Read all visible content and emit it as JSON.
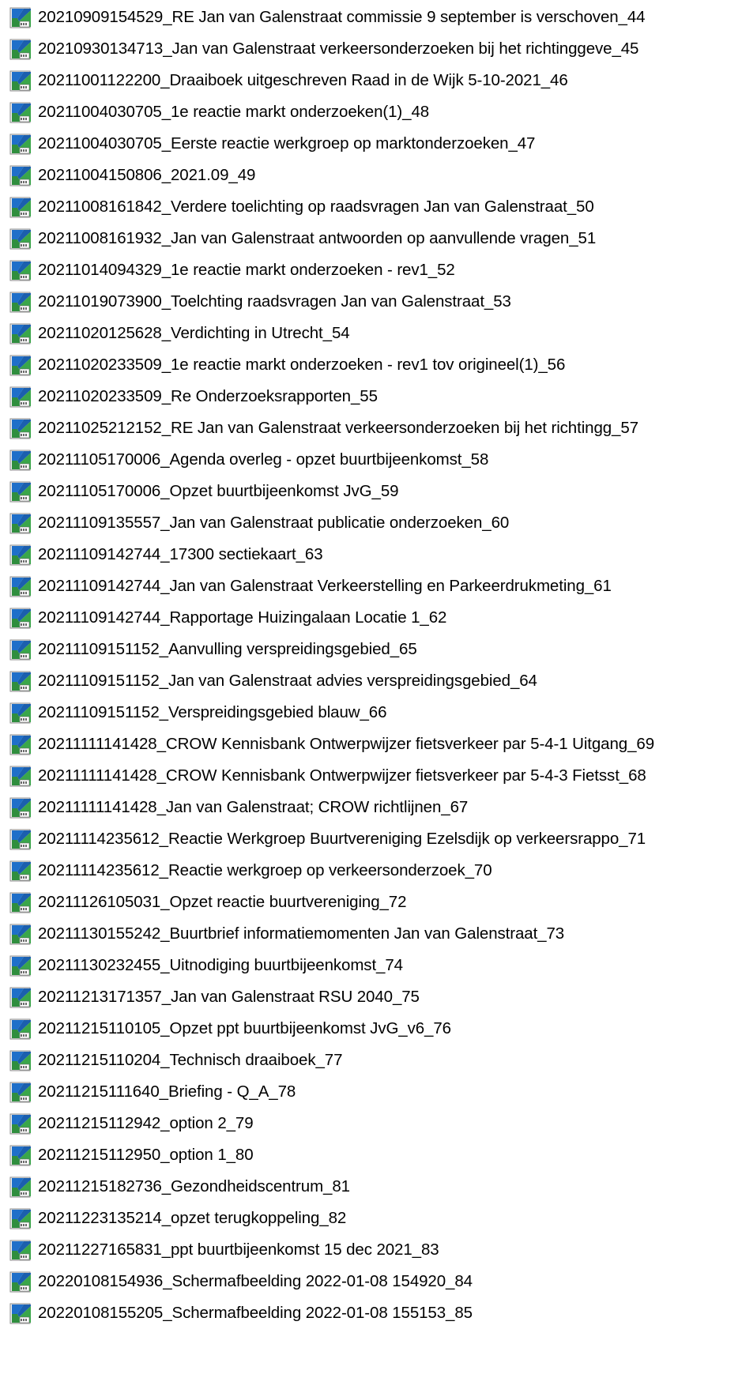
{
  "icon": "pdf-app-icon",
  "colors": {
    "icon_blue": "#1f6fc9",
    "icon_green": "#3aa64a",
    "icon_page": "#f2f2f2",
    "text": "#000000",
    "background": "#ffffff"
  },
  "files": [
    "20210909154529_RE Jan van Galenstraat commissie 9 september is verschoven_44",
    "20210930134713_Jan van Galenstraat verkeersonderzoeken bij het richtinggeve_45",
    "20211001122200_Draaiboek uitgeschreven Raad in de Wijk 5-10-2021_46",
    "20211004030705_1e reactie markt onderzoeken(1)_48",
    "20211004030705_Eerste reactie werkgroep op marktonderzoeken_47",
    "20211004150806_2021.09_49",
    "20211008161842_Verdere toelichting op raadsvragen Jan van Galenstraat_50",
    "20211008161932_Jan van Galenstraat antwoorden op aanvullende vragen_51",
    "20211014094329_1e reactie markt onderzoeken - rev1_52",
    "20211019073900_Toelchting raadsvragen Jan van Galenstraat_53",
    "20211020125628_Verdichting in Utrecht_54",
    "20211020233509_1e reactie markt onderzoeken - rev1 tov origineel(1)_56",
    "20211020233509_Re Onderzoeksrapporten_55",
    "20211025212152_RE Jan van Galenstraat verkeersonderzoeken bij het richtingg_57",
    "20211105170006_Agenda overleg - opzet buurtbijeenkomst_58",
    "20211105170006_Opzet buurtbijeenkomst JvG_59",
    "20211109135557_Jan van Galenstraat publicatie onderzoeken_60",
    "20211109142744_17300 sectiekaart_63",
    "20211109142744_Jan van Galenstraat Verkeerstelling en Parkeerdrukmeting_61",
    "20211109142744_Rapportage Huizingalaan Locatie 1_62",
    "20211109151152_Aanvulling verspreidingsgebied_65",
    "20211109151152_Jan van Galenstraat advies verspreidingsgebied_64",
    "20211109151152_Verspreidingsgebied blauw_66",
    "20211111141428_CROW Kennisbank Ontwerpwijzer fietsverkeer par 5-4-1 Uitgang_69",
    "20211111141428_CROW Kennisbank Ontwerpwijzer fietsverkeer par 5-4-3 Fietsst_68",
    "20211111141428_Jan van Galenstraat; CROW richtlijnen_67",
    "20211114235612_Reactie Werkgroep Buurtvereniging Ezelsdijk op verkeersrappo_71",
    "20211114235612_Reactie werkgroep op verkeersonderzoek_70",
    "20211126105031_Opzet reactie buurtvereniging_72",
    "20211130155242_Buurtbrief informatiemomenten Jan van Galenstraat_73",
    "20211130232455_Uitnodiging buurtbijeenkomst_74",
    "20211213171357_Jan van Galenstraat RSU 2040_75",
    "20211215110105_Opzet ppt buurtbijeenkomst JvG_v6_76",
    "20211215110204_Technisch draaiboek_77",
    "20211215111640_Briefing - Q_A_78",
    "20211215112942_option 2_79",
    "20211215112950_option 1_80",
    "20211215182736_Gezondheidscentrum_81",
    "20211223135214_opzet terugkoppeling_82",
    "20211227165831_ppt buurtbijeenkomst 15 dec 2021_83",
    "20220108154936_Schermafbeelding 2022-01-08 154920_84",
    "20220108155205_Schermafbeelding 2022-01-08 155153_85"
  ]
}
